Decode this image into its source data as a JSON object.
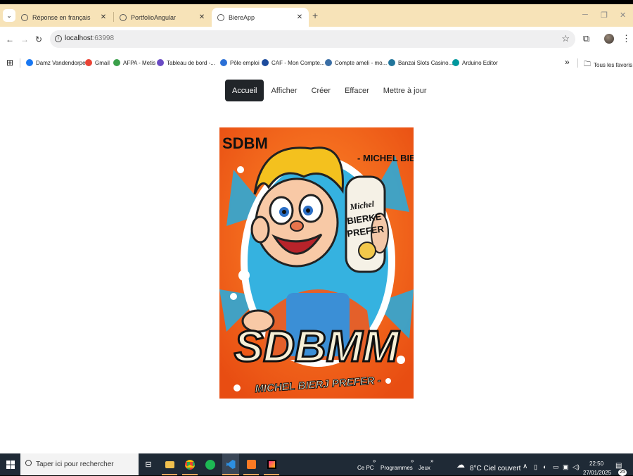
{
  "browser": {
    "tabs": [
      {
        "label": "Réponse en français",
        "close": "✕"
      },
      {
        "label": "PortfolioAngular",
        "close": "✕"
      },
      {
        "label": "BiereApp",
        "close": "✕"
      }
    ],
    "new_tab": "+",
    "tab_menu": "⌄",
    "address": {
      "host": "localhost",
      "port": ":63998"
    },
    "bookmarks": [
      {
        "label": "Damz Vandendorpe",
        "color": "#1877f2"
      },
      {
        "label": "Gmail",
        "color": "#ea4335"
      },
      {
        "label": "AFPA - Metis",
        "color": "#3aa04a"
      },
      {
        "label": "Tableau de bord -...",
        "color": "#6a4bc4"
      },
      {
        "label": "Pôle emploi",
        "color": "#2a6fd6"
      },
      {
        "label": "CAF - Mon Compte...",
        "color": "#1c4b9c"
      },
      {
        "label": "Compte ameli - mo...",
        "color": "#3a6ea5"
      },
      {
        "label": "Banzai Slots Casino...",
        "color": "#21759b"
      },
      {
        "label": "Arduino Editor",
        "color": "#00979d"
      }
    ],
    "bookmarks_more": "»",
    "all_bookmarks": "Tous les favoris"
  },
  "page": {
    "nav": [
      {
        "label": "Accueil",
        "active": true
      },
      {
        "label": "Afficher"
      },
      {
        "label": "Créer"
      },
      {
        "label": "Effacer"
      },
      {
        "label": "Mettre à jour"
      }
    ],
    "poster": {
      "brand_small": "SDBM",
      "brand_big": "SDBMM",
      "tagline_top": "- MICHEL BIERKEJ",
      "tagline_bottom": "MICHEL BIERJ PREFER -",
      "can_line1": "Michel",
      "can_line2": "BIERKE",
      "can_line3": "PREFER"
    }
  },
  "taskbar": {
    "search_placeholder": "Taper ici pour rechercher",
    "links": [
      "Ce PC",
      "Programmes",
      "Jeux"
    ],
    "weather": "8°C  Ciel couvert",
    "time": "22:50",
    "date": "27/01/2025",
    "notifications": "25"
  }
}
